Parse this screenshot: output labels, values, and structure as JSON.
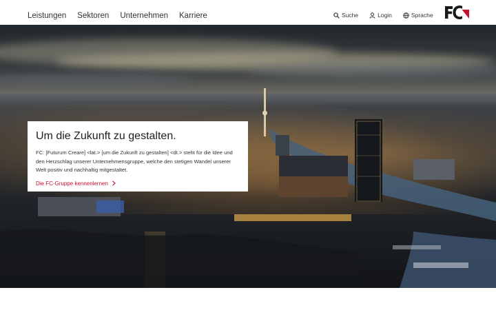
{
  "header": {
    "nav": [
      {
        "label": "Leistungen"
      },
      {
        "label": "Sektoren"
      },
      {
        "label": "Unternehmen"
      },
      {
        "label": "Karriere"
      }
    ],
    "utils": {
      "search": {
        "label": "Suche",
        "icon": "search-icon"
      },
      "login": {
        "label": "Login",
        "icon": "user-icon"
      },
      "language": {
        "label": "Sprache",
        "icon": "globe-icon"
      }
    },
    "logo": {
      "text": "FC",
      "accent_color": "#c8102e",
      "color": "#1a1a1a"
    }
  },
  "hero": {
    "card": {
      "title": "Um die Zukunft zu gestalten.",
      "text": "FC: [Futurum Creare] <lat.> [um die Zukunft zu gestalten] <dt.> steht für die Idee und den Herzschlag unserer Unternehmensgruppe, welche den stetigen Wandel unserer Welt positiv und nachhaltig mitgestaltet.",
      "link": "Die FC-Gruppe kennenlernen"
    }
  },
  "colors": {
    "accent": "#c8102e",
    "text": "#333333",
    "background": "#ffffff"
  }
}
